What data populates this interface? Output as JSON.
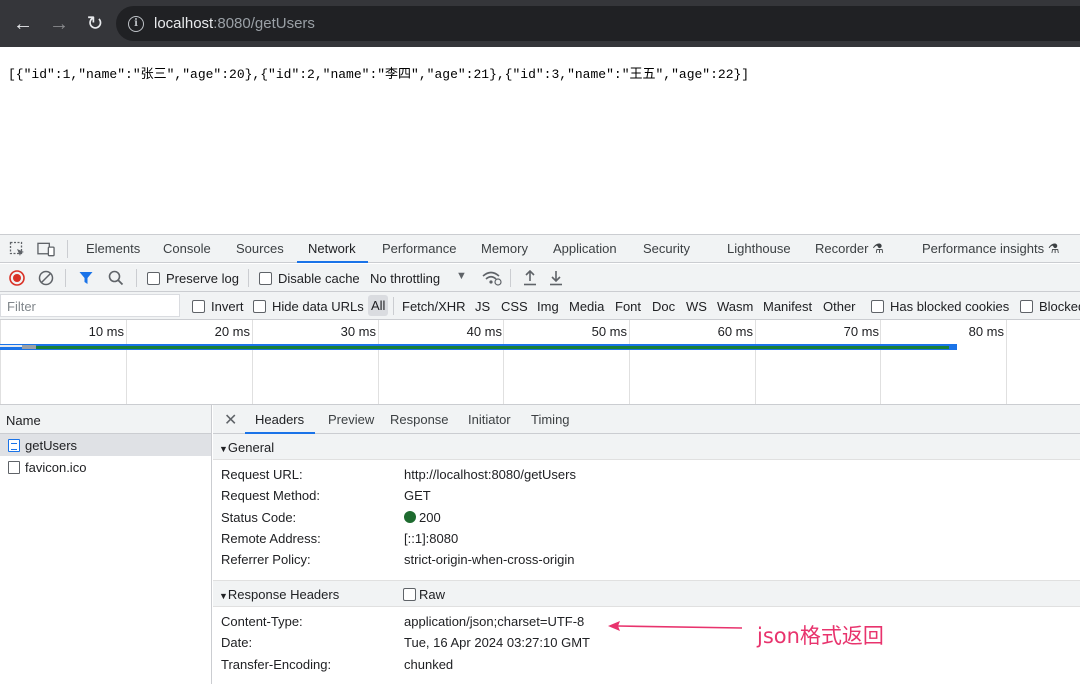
{
  "browser": {
    "url_host": "localhost",
    "url_path": ":8080/getUsers"
  },
  "page": {
    "json_text": "[{\"id\":1,\"name\":\"张三\",\"age\":20},{\"id\":2,\"name\":\"李四\",\"age\":21},{\"id\":3,\"name\":\"王五\",\"age\":22}]"
  },
  "devtools": {
    "tabs": [
      "Elements",
      "Console",
      "Sources",
      "Network",
      "Performance",
      "Memory",
      "Application",
      "Security",
      "Lighthouse",
      "Recorder",
      "Performance insights"
    ],
    "active_tab": "Network",
    "toolbar": {
      "preserve_log": "Preserve log",
      "disable_cache": "Disable cache",
      "throttling": "No throttling"
    },
    "filter": {
      "placeholder": "Filter",
      "invert": "Invert",
      "hide_data_urls": "Hide data URLs",
      "types": [
        "All",
        "Fetch/XHR",
        "JS",
        "CSS",
        "Img",
        "Media",
        "Font",
        "Doc",
        "WS",
        "Wasm",
        "Manifest",
        "Other"
      ],
      "has_blocked_cookies": "Has blocked cookies",
      "blocked": "Blocked"
    },
    "timeline": {
      "ticks": [
        "10 ms",
        "20 ms",
        "30 ms",
        "40 ms",
        "50 ms",
        "60 ms",
        "70 ms",
        "80 ms"
      ]
    },
    "requests": {
      "header": "Name",
      "items": [
        "getUsers",
        "favicon.ico"
      ]
    },
    "detail": {
      "tabs": [
        "Headers",
        "Preview",
        "Response",
        "Initiator",
        "Timing"
      ],
      "general": {
        "title": "General",
        "rows": [
          {
            "key": "Request URL:",
            "value": "http://localhost:8080/getUsers"
          },
          {
            "key": "Request Method:",
            "value": "GET"
          },
          {
            "key": "Status Code:",
            "value": "200"
          },
          {
            "key": "Remote Address:",
            "value": "[::1]:8080"
          },
          {
            "key": "Referrer Policy:",
            "value": "strict-origin-when-cross-origin"
          }
        ]
      },
      "response_headers": {
        "title": "Response Headers",
        "raw_label": "Raw",
        "rows": [
          {
            "key": "Content-Type:",
            "value": "application/json;charset=UTF-8"
          },
          {
            "key": "Date:",
            "value": "Tue, 16 Apr 2024 03:27:10 GMT"
          },
          {
            "key": "Transfer-Encoding:",
            "value": "chunked"
          }
        ]
      }
    }
  },
  "annotation": {
    "text": "json格式返回",
    "color": "#e8336d"
  }
}
